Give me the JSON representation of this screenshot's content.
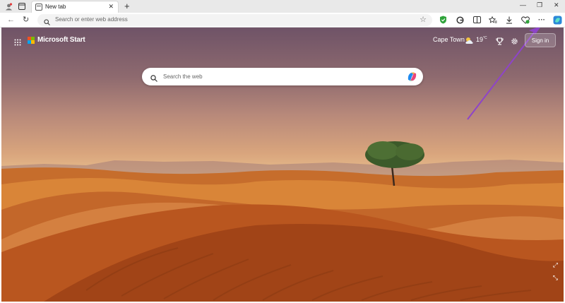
{
  "browser": {
    "tab_title": "New tab",
    "tab_close": "✕",
    "new_tab": "+",
    "address_placeholder": "Search or enter web address",
    "window_controls": [
      "—",
      "❐",
      "✕"
    ],
    "more_menu": "···"
  },
  "page": {
    "brand": "Microsoft Start",
    "city": "Cape Town",
    "temperature": "19",
    "temp_unit": "°C",
    "signin_label": "Sign in",
    "search_placeholder": "Search the web"
  },
  "colors": {
    "annotation_arrow": "#8e44c8",
    "ms_logo": [
      "#f25022",
      "#7fba00",
      "#00a4ef",
      "#ffb900"
    ]
  }
}
